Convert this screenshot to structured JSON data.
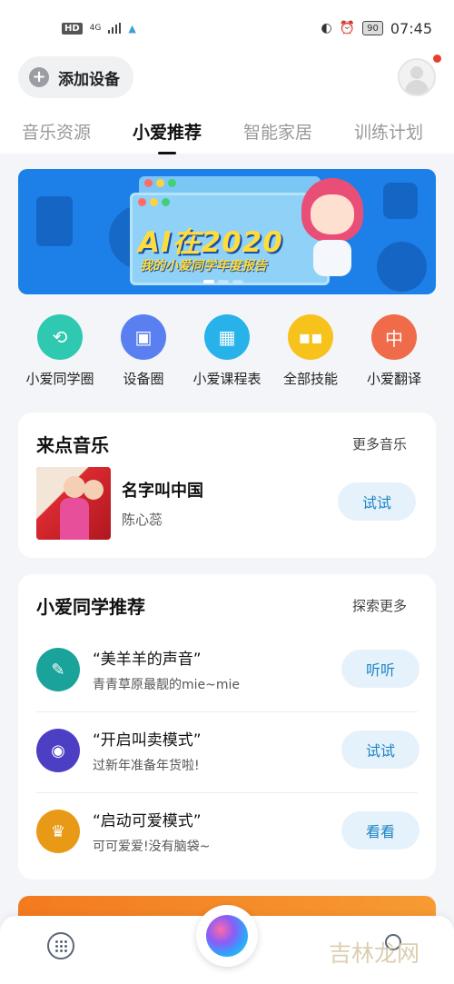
{
  "status_bar": {
    "hd": "HD",
    "net": "4G",
    "battery": "90",
    "time": "07:45"
  },
  "header": {
    "add_device": "添加设备",
    "plus_glyph": "+"
  },
  "tabs": [
    {
      "label": "音乐资源",
      "active": false
    },
    {
      "label": "小爱推荐",
      "active": true
    },
    {
      "label": "智能家居",
      "active": false
    },
    {
      "label": "训练计划",
      "active": false
    }
  ],
  "banner": {
    "title": "AI在2020",
    "subtitle": "我的小爱同学年度报告",
    "page_index": 1,
    "page_count": 3
  },
  "quick_actions": [
    {
      "label": "小爱同学圈",
      "color": "#2ec9b0",
      "icon": "share-icon",
      "glyph": "⟲"
    },
    {
      "label": "设备圈",
      "color": "#5a7ff0",
      "icon": "speaker-icon",
      "glyph": "▣"
    },
    {
      "label": "小爱课程表",
      "color": "#27b3ea",
      "icon": "calendar-icon",
      "glyph": "▦"
    },
    {
      "label": "全部技能",
      "color": "#f7c21c",
      "icon": "grid-icon",
      "glyph": "▪▪"
    },
    {
      "label": "小爱翻译",
      "color": "#f06b4a",
      "icon": "translate-icon",
      "glyph": "中"
    }
  ],
  "music_card": {
    "title": "来点音乐",
    "more": "更多音乐",
    "song_title": "名字叫中国",
    "artist": "陈心蕊",
    "button": "试试"
  },
  "recommend_card": {
    "title": "小爱同学推荐",
    "more": "探索更多",
    "items": [
      {
        "title": "“美羊羊的声音”",
        "subtitle": "青青草原最靓的mie~mie",
        "button": "听听",
        "color": "#1aa39a",
        "icon": "tag-icon",
        "glyph": "✎"
      },
      {
        "title": "“开启叫卖模式”",
        "subtitle": "过新年准备年货啦!",
        "button": "试试",
        "color": "#4d3fc4",
        "icon": "whistle-icon",
        "glyph": "◉"
      },
      {
        "title": "“启动可爱模式”",
        "subtitle": "可可爱爱!没有脑袋~",
        "button": "看看",
        "color": "#e89a16",
        "icon": "crown-icon",
        "glyph": "♛"
      }
    ]
  },
  "watermark": "吉林龙网"
}
